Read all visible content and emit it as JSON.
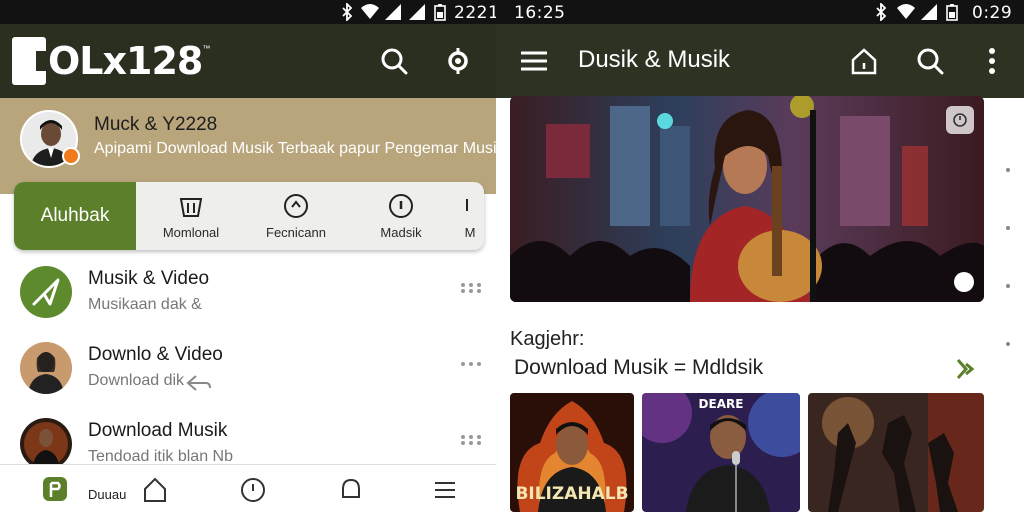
{
  "colors": {
    "appbar": "#2b2f1f",
    "profile_band": "#b9a57c",
    "accent_green": "#5b7f2b",
    "badge_orange": "#f07b1c"
  },
  "left": {
    "status": {
      "time": "2221",
      "icons": [
        "bluetooth-icon",
        "wifi-icon",
        "signal-icon",
        "battery-icon"
      ]
    },
    "appbar": {
      "logo": "OLx128",
      "logo_tm": "™",
      "icons": [
        "search-icon",
        "settings-icon"
      ]
    },
    "profile": {
      "name": "Muck & Y2228",
      "subtitle": "Apipami Download Musik Terbaak papur Pengemar Musik"
    },
    "tabs": [
      {
        "label": "Aluhbak",
        "icon": ""
      },
      {
        "label": "Momlonal",
        "icon": "bucket-icon"
      },
      {
        "label": "Fecnicann",
        "icon": "circle-arrow-icon"
      },
      {
        "label": "Madsik",
        "icon": "circle-dot-icon"
      },
      {
        "label": "M",
        "icon": ""
      }
    ],
    "list": [
      {
        "title": "Musik & Video",
        "subtitle": "Musikaan dak &",
        "thumb": "send-icon"
      },
      {
        "title": "Downlo & Video",
        "subtitle": "Download dik",
        "thumb": "person-thumb"
      },
      {
        "title": "Download Musik",
        "subtitle": "Tendoad itik  blan Nb",
        "thumb": "singer-thumb"
      }
    ],
    "bottom_nav": {
      "label": "Duuau",
      "icons": [
        "app-icon",
        "home-icon",
        "clock-icon",
        "bell-icon",
        "menu-lines-icon"
      ]
    }
  },
  "right": {
    "status": {
      "time": "16:25",
      "right_time": "0:29"
    },
    "appbar": {
      "title": "Dusik & Musik",
      "icons": [
        "menu-icon",
        "home-icon",
        "search-icon",
        "more-vert-icon"
      ]
    },
    "section": {
      "label": "Kagjehr:",
      "title": "Download Musik = Mdldsik"
    },
    "cards": [
      {
        "caption": "BILIZAHALB",
        "top": ""
      },
      {
        "caption": "",
        "top": "DEARE"
      },
      {
        "caption": "",
        "top": ""
      }
    ]
  }
}
